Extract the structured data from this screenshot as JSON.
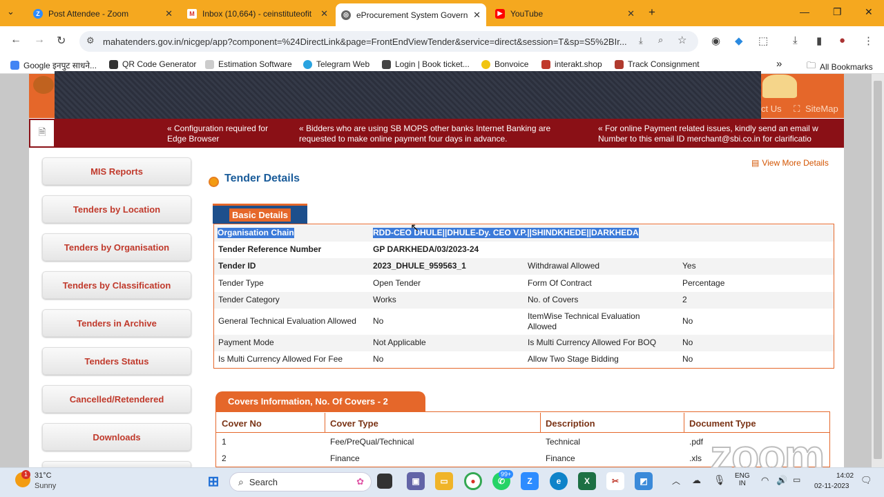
{
  "browser": {
    "tabs": [
      {
        "title": "Post Attendee - Zoom",
        "icon": "zoom-icon",
        "active": false
      },
      {
        "title": "Inbox (10,664) - ceinstituteofit",
        "icon": "gmail-icon",
        "active": false
      },
      {
        "title": "eProcurement System Governm",
        "icon": "globe-icon",
        "active": true
      },
      {
        "title": "YouTube",
        "icon": "youtube-icon",
        "active": false
      }
    ],
    "new_tab": "+",
    "url": "mahatenders.gov.in/nicgep/app?component=%24DirectLink&page=FrontEndViewTender&service=direct&session=T&sp=S5%2BIr...",
    "bookmarks": [
      "Google इनपुट साधने...",
      "QR Code Generator",
      "Estimation Software",
      "Telegram Web",
      "Login | Book ticket...",
      "Bonvoice",
      "interakt.shop",
      "Track Consignment"
    ],
    "bookmarks_more": "»",
    "all_bookmarks": "All Bookmarks"
  },
  "site": {
    "top_links": [
      "ct Us",
      "SiteMap"
    ],
    "marquee": [
      "« Configuration required for\nEdge Browser",
      "« Bidders who are using SB MOPS other banks Internet Banking are\nrequested to make online payment four days in advance.",
      "« For online Payment related issues, kindly send an email w\nNumber to this email ID merchant@sbi.co.in for clarificatio"
    ],
    "sidebar": [
      "MIS Reports",
      "Tenders by Location",
      "Tenders by Organisation",
      "Tenders by Classification",
      "Tenders in Archive",
      "Tenders Status",
      "Cancelled/Retendered",
      "Downloads"
    ],
    "page_title": "Tender Details",
    "view_more": "View More Details",
    "basic_tab": "Basic Details",
    "basic": {
      "org_label": "Organisation Chain",
      "org_value": "RDD-CEO DHULE||DHULE-Dy. CEO V.P.||SHINDKHEDE||DARKHEDA",
      "ref_label": "Tender Reference Number",
      "ref_value": "GP DARKHEDA/03/2023-24",
      "id_label": "Tender ID",
      "id_value": "2023_DHULE_959563_1",
      "withdraw_label": "Withdrawal Allowed",
      "withdraw_value": "Yes",
      "type_label": "Tender Type",
      "type_value": "Open Tender",
      "contract_label": "Form Of Contract",
      "contract_value": "Percentage",
      "category_label": "Tender Category",
      "category_value": "Works",
      "covers_label": "No. of Covers",
      "covers_value": "2",
      "gte_label": "General Technical Evaluation Allowed",
      "gte_value": "No",
      "itemwise_label": "ItemWise Technical Evaluation Allowed",
      "itemwise_value": "No",
      "payment_label": "Payment Mode",
      "payment_value": "Not Applicable",
      "boq_label": "Is Multi Currency Allowed For BOQ",
      "boq_value": "No",
      "fee_label": "Is Multi Currency Allowed For Fee",
      "fee_value": "No",
      "twostage_label": "Allow Two Stage Bidding",
      "twostage_value": "No"
    },
    "covers_tab": "Covers Information, No. Of Covers - 2",
    "covers_headers": [
      "Cover No",
      "Cover Type",
      "Description",
      "Document Type"
    ],
    "covers_rows": [
      [
        "1",
        "Fee/PreQual/Technical",
        "Technical",
        ".pdf"
      ],
      [
        "2",
        "Finance",
        "Finance",
        ".xls"
      ]
    ]
  },
  "watermark": "zoom",
  "taskbar": {
    "weather_temp": "31°C",
    "weather_desc": "Sunny",
    "weather_badge": "1",
    "search": "Search",
    "lang1": "ENG",
    "lang2": "IN",
    "time": "14:02",
    "date": "02-11-2023",
    "badge": "99+"
  }
}
